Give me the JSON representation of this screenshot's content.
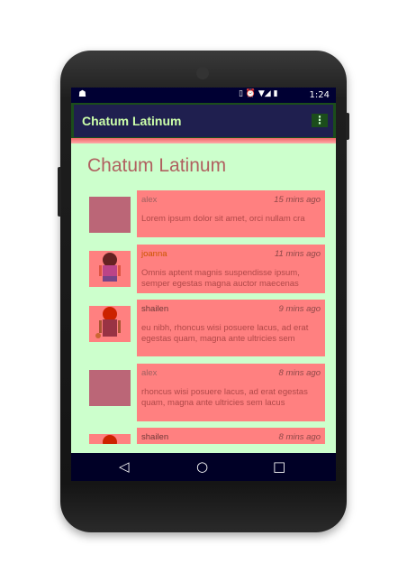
{
  "status_bar": {
    "time": "1:24"
  },
  "app_bar": {
    "title": "Chatum Latinum",
    "menu_icon": "overflow-menu-icon"
  },
  "heading": "Chatum Latinum",
  "messages": [
    {
      "name": "alex",
      "time": "15 mins ago",
      "text": "Lorem ipsum dolor sit amet, orci nullam cra"
    },
    {
      "name": "joanna",
      "time": "11 mins ago",
      "text": "Omnis aptent magnis suspendisse ipsum, semper egestas magna auctor maecenas"
    },
    {
      "name": "shailen",
      "time": "9 mins ago",
      "text": "eu nibh, rhoncus wisi posuere lacus, ad erat egestas quam, magna ante ultricies sem"
    },
    {
      "name": "alex",
      "time": "8 mins ago",
      "text": "rhoncus wisi posuere lacus, ad erat egestas quam, magna ante ultricies sem lacus"
    },
    {
      "name": "shailen",
      "time": "8 mins ago",
      "text": ""
    }
  ],
  "nav": {
    "back": "◁",
    "home": "○",
    "recents": "□"
  }
}
